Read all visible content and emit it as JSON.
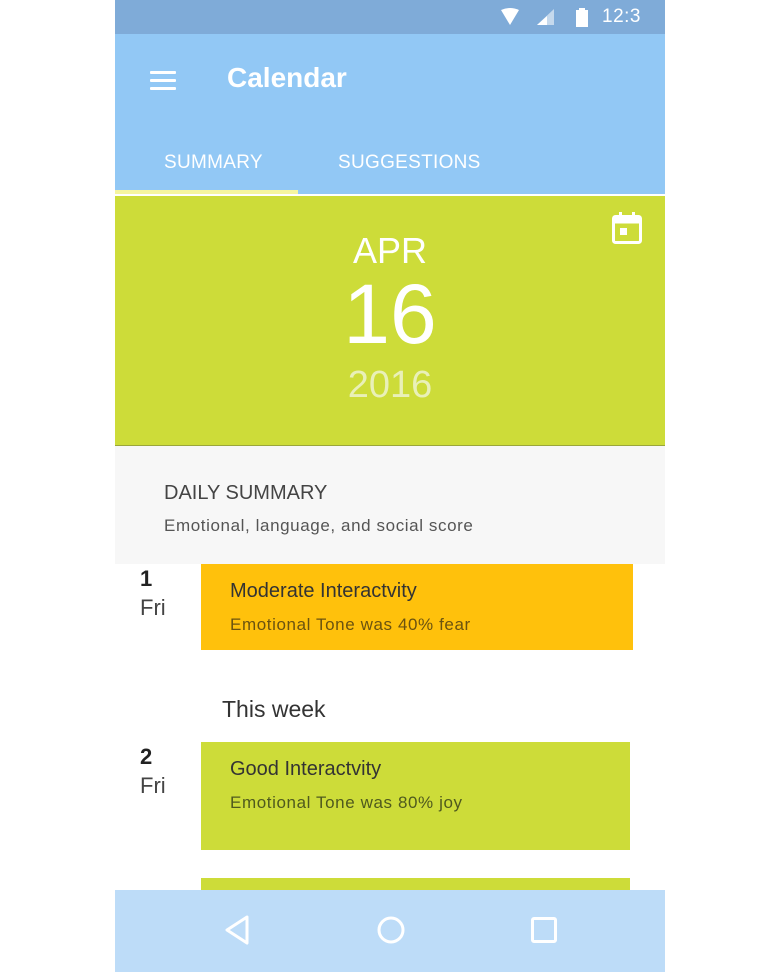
{
  "status_bar": {
    "time": "12:3",
    "icons": [
      "wifi-icon",
      "signal-icon",
      "battery-icon"
    ]
  },
  "app_bar": {
    "title": "Calendar",
    "menu_icon": "menu-icon",
    "tabs": [
      {
        "label": "SUMMARY",
        "selected": true
      },
      {
        "label": "SUGGESTIONS",
        "selected": false
      }
    ]
  },
  "date_header": {
    "month": "APR",
    "day": "16",
    "year": "2016",
    "icon": "calendar-icon",
    "color": "#cddc39"
  },
  "summary": {
    "title": "DAILY SUMMARY",
    "subtitle": "Emotional, language, and social score"
  },
  "entries": [
    {
      "num": "1",
      "day": "Fri",
      "title": "Moderate Interactvity",
      "subtitle": "Emotional Tone was 40% fear",
      "color": "#ffc10c"
    },
    {
      "num": "2",
      "day": "Fri",
      "title": "Good Interactvity",
      "subtitle": "Emotional Tone was 80% joy",
      "color": "#cddc39"
    }
  ],
  "section_label": "This week",
  "nav_bar": {
    "buttons": [
      "back-icon",
      "home-icon",
      "recents-icon"
    ]
  },
  "colors": {
    "status_bar": "#7fabd8",
    "app_bar": "#92c8f5",
    "tab_indicator": "#f5f5a0",
    "nav_bar": "#bddcf8"
  }
}
